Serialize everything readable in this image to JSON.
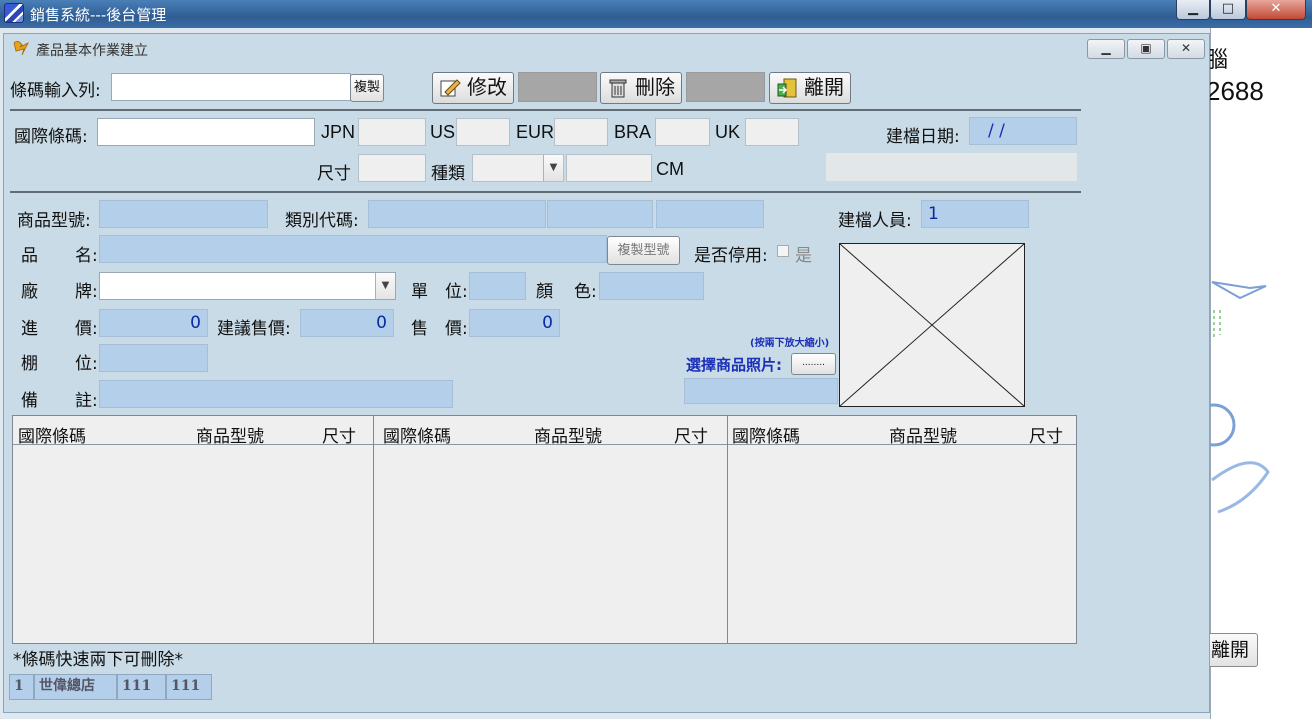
{
  "app": {
    "title": "銷售系統---後台管理"
  },
  "background": {
    "partial_char": "腦",
    "partial_number": "2688",
    "exit_label": "離開"
  },
  "window": {
    "title": "產品基本作業建立"
  },
  "toolbar": {
    "barcode_label": "條碼輸入列:",
    "barcode_value": "",
    "copy_button": "複製",
    "edit_button": "修改",
    "delete_button": "刪除",
    "exit_button": "離開"
  },
  "size_row": {
    "intl_barcode_label": "國際條碼:",
    "jpn": "JPN",
    "us": "US",
    "eur": "EUR",
    "bra": "BRA",
    "uk": "UK",
    "created_date_label": "建檔日期:",
    "created_date_value": "/ /",
    "size_label": "尺寸",
    "kind_label": "種類",
    "cm_label": "CM"
  },
  "product": {
    "model_label": "商品型號:",
    "category_label": "類別代碼:",
    "creator_label": "建檔人員:",
    "creator_value": "1",
    "name_label_1": "品",
    "name_label_2": "名:",
    "copy_model_button": "複製型號",
    "disabled_label": "是否停用:",
    "disabled_option": "是",
    "brand_label_1": "廠",
    "brand_label_2": "牌:",
    "unit_label_1": "單",
    "unit_label_2": "位:",
    "color_label_1": "顏",
    "color_label_2": "色:",
    "cost_label_1": "進",
    "cost_label_2": "價:",
    "cost_value": "0",
    "suggested_price_label": "建議售價:",
    "suggested_price_value": "0",
    "price_label_1": "售",
    "price_label_2": "價:",
    "price_value": "0",
    "shelf_label_1": "棚",
    "shelf_label_2": "位:",
    "note_label_1": "備",
    "note_label_2": "註:",
    "photo_hint": "(按兩下放大縮小)",
    "photo_select_label": "選擇商品照片:",
    "photo_browse_button": "........"
  },
  "grids": [
    {
      "col1": "國際條碼",
      "col2": "商品型號",
      "col3": "尺寸"
    },
    {
      "col1": "國際條碼",
      "col2": "商品型號",
      "col3": "尺寸"
    },
    {
      "col1": "國際條碼",
      "col2": "商品型號",
      "col3": "尺寸"
    }
  ],
  "footer": {
    "hint": "*條碼快速兩下可刪除*",
    "status": [
      "1",
      "世偉總店",
      "111",
      "111"
    ]
  }
}
